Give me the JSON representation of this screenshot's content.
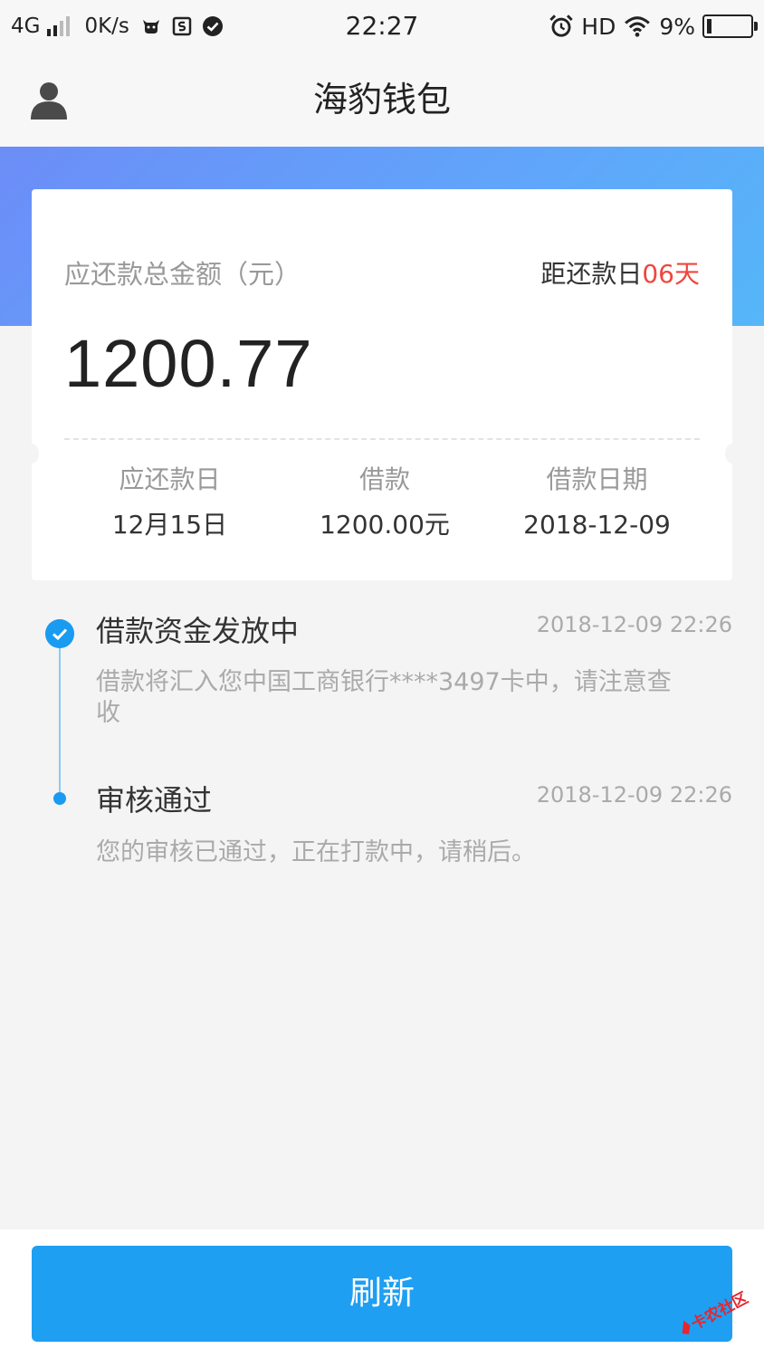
{
  "status_bar": {
    "network": "4G",
    "speed": "0K/s",
    "time": "22:27",
    "hd": "HD",
    "battery": "9%"
  },
  "nav": {
    "title": "海豹钱包"
  },
  "card": {
    "total_label": "应还款总金额（元）",
    "countdown_prefix": "距还款日",
    "countdown_days": "06天",
    "amount": "1200.77",
    "info": [
      {
        "label": "应还款日",
        "value": "12月15日"
      },
      {
        "label": "借款",
        "value": "1200.00元"
      },
      {
        "label": "借款日期",
        "value": "2018-12-09"
      }
    ]
  },
  "timeline": [
    {
      "title": "借款资金发放中",
      "time": "2018-12-09 22:26",
      "desc": "借款将汇入您中国工商银行****3497卡中，请注意查收"
    },
    {
      "title": "审核通过",
      "time": "2018-12-09 22:26",
      "desc": "您的审核已通过，正在打款中，请稍后。"
    }
  ],
  "bottom": {
    "refresh_label": "刷新",
    "watermark": "卡农社区"
  },
  "colors": {
    "primary": "#1e9ff2",
    "highlight_red": "#f0463c",
    "banner_start": "#6c8df7",
    "banner_end": "#55b6f8"
  },
  "icons": [
    "user-icon",
    "check-icon",
    "wifi-icon",
    "alarm-icon",
    "battery-icon"
  ]
}
